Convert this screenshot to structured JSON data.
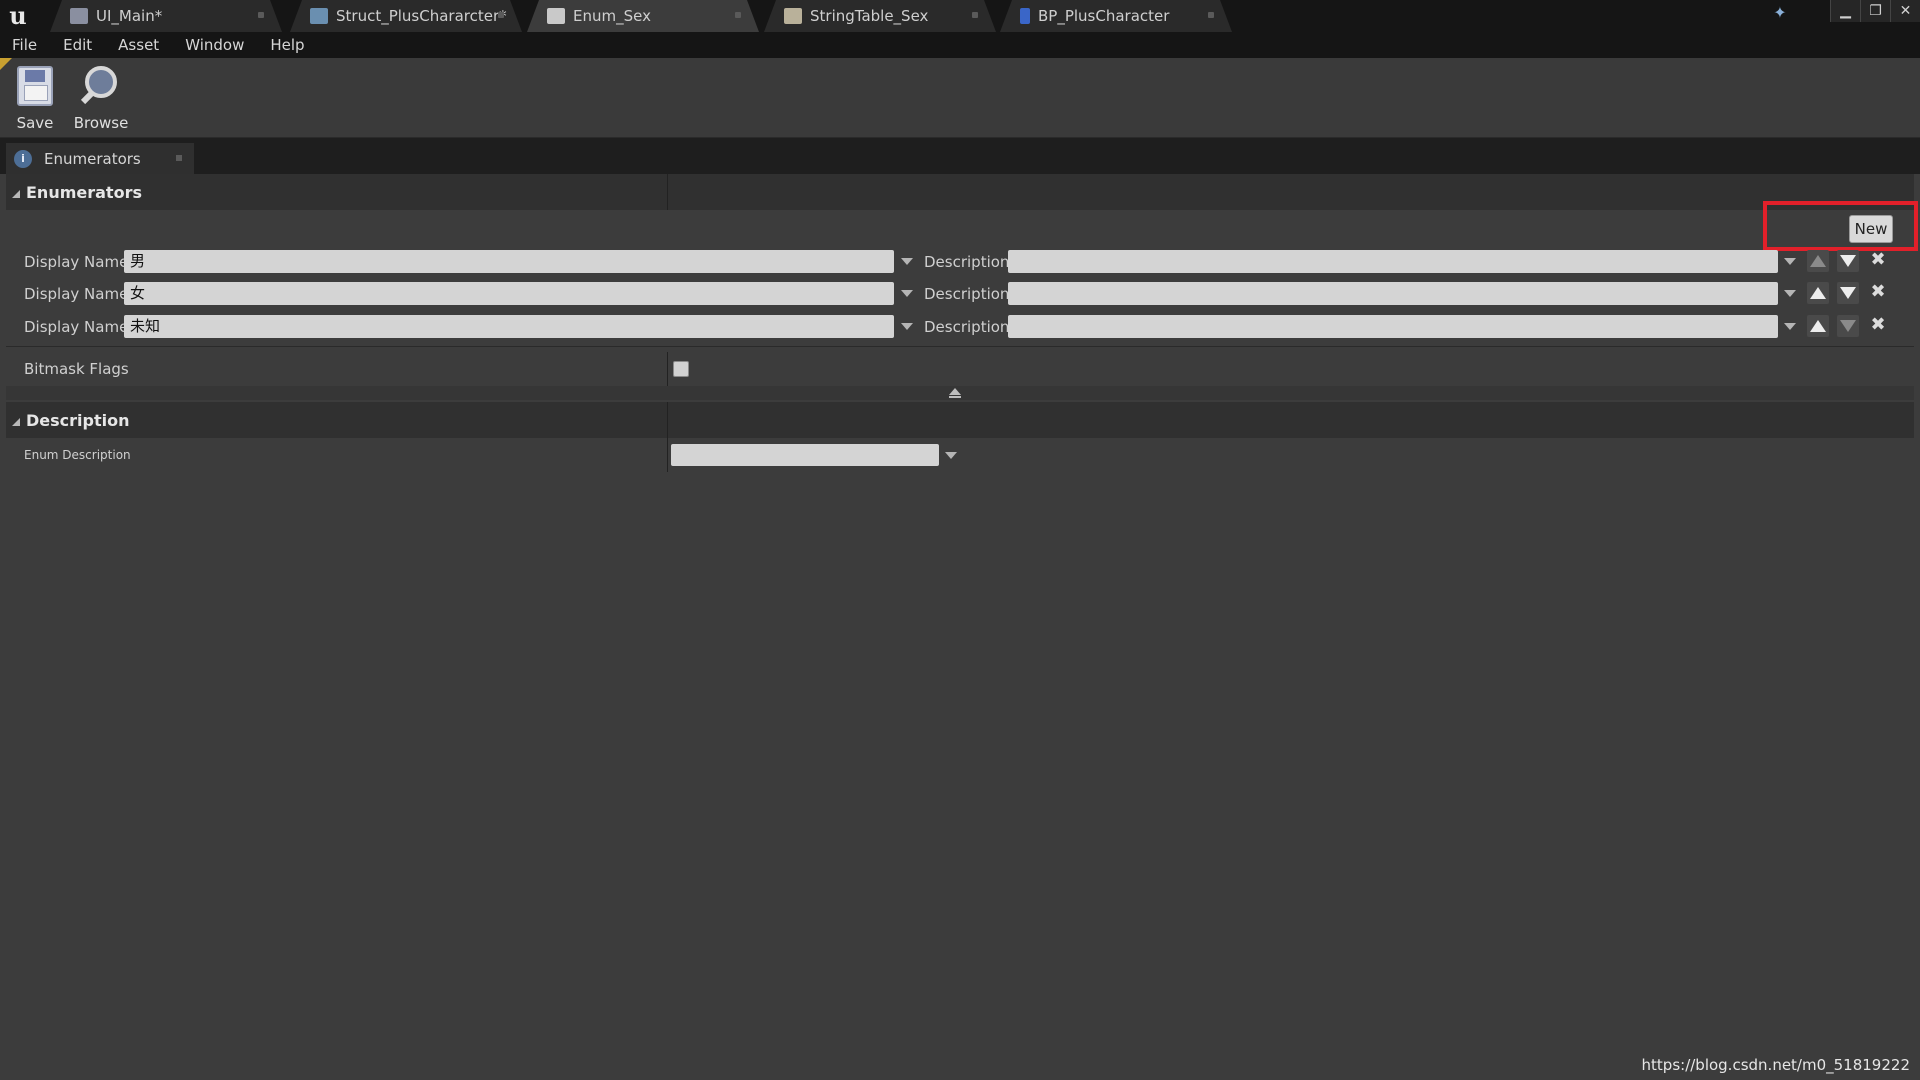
{
  "titlebar": {
    "tabs": [
      {
        "label": "UI_Main*",
        "icon": "widget-blueprint-icon",
        "active": false
      },
      {
        "label": "Struct_PlusChararcter*",
        "icon": "struct-icon",
        "active": false
      },
      {
        "label": "Enum_Sex",
        "icon": "enum-icon",
        "active": true
      },
      {
        "label": "StringTable_Sex",
        "icon": "string-table-icon",
        "active": false
      },
      {
        "label": "BP_PlusCharacter",
        "icon": "blueprint-icon",
        "active": false
      }
    ]
  },
  "menubar": {
    "items": [
      "File",
      "Edit",
      "Asset",
      "Window",
      "Help"
    ]
  },
  "toolbar": {
    "save_label": "Save",
    "browse_label": "Browse"
  },
  "panel": {
    "tab_label": "Enumerators"
  },
  "enumerators": {
    "header": "Enumerators",
    "new_label": "New",
    "rows": [
      {
        "display_label": "Display Name",
        "value": "男",
        "desc_label": "Description",
        "desc_value": ""
      },
      {
        "display_label": "Display Name",
        "value": "女",
        "desc_label": "Description",
        "desc_value": ""
      },
      {
        "display_label": "Display Name",
        "value": "未知",
        "desc_label": "Description",
        "desc_value": ""
      }
    ],
    "bitmask_label": "Bitmask Flags",
    "bitmask_checked": false
  },
  "description": {
    "header": "Description",
    "enum_description_label": "Enum Description",
    "enum_description_value": ""
  },
  "watermark": "https://blog.csdn.net/m0_51819222",
  "colors": {
    "highlight": "#e2202a",
    "background": "#3c3c3c",
    "input": "#d4d4d4"
  }
}
